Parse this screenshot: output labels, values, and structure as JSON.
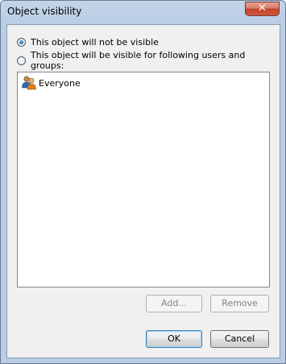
{
  "window": {
    "title": "Object visibility",
    "close_glyph": "✕"
  },
  "options": {
    "not_visible_label": "This object will not be visible",
    "visible_for_label": "This object will be visible for following users and groups:",
    "selected": "not_visible"
  },
  "list": {
    "items": [
      {
        "label": "Everyone",
        "icon": "users-group-icon"
      }
    ]
  },
  "buttons": {
    "add_label": "Add...",
    "remove_label": "Remove",
    "ok_label": "OK",
    "cancel_label": "Cancel"
  }
}
